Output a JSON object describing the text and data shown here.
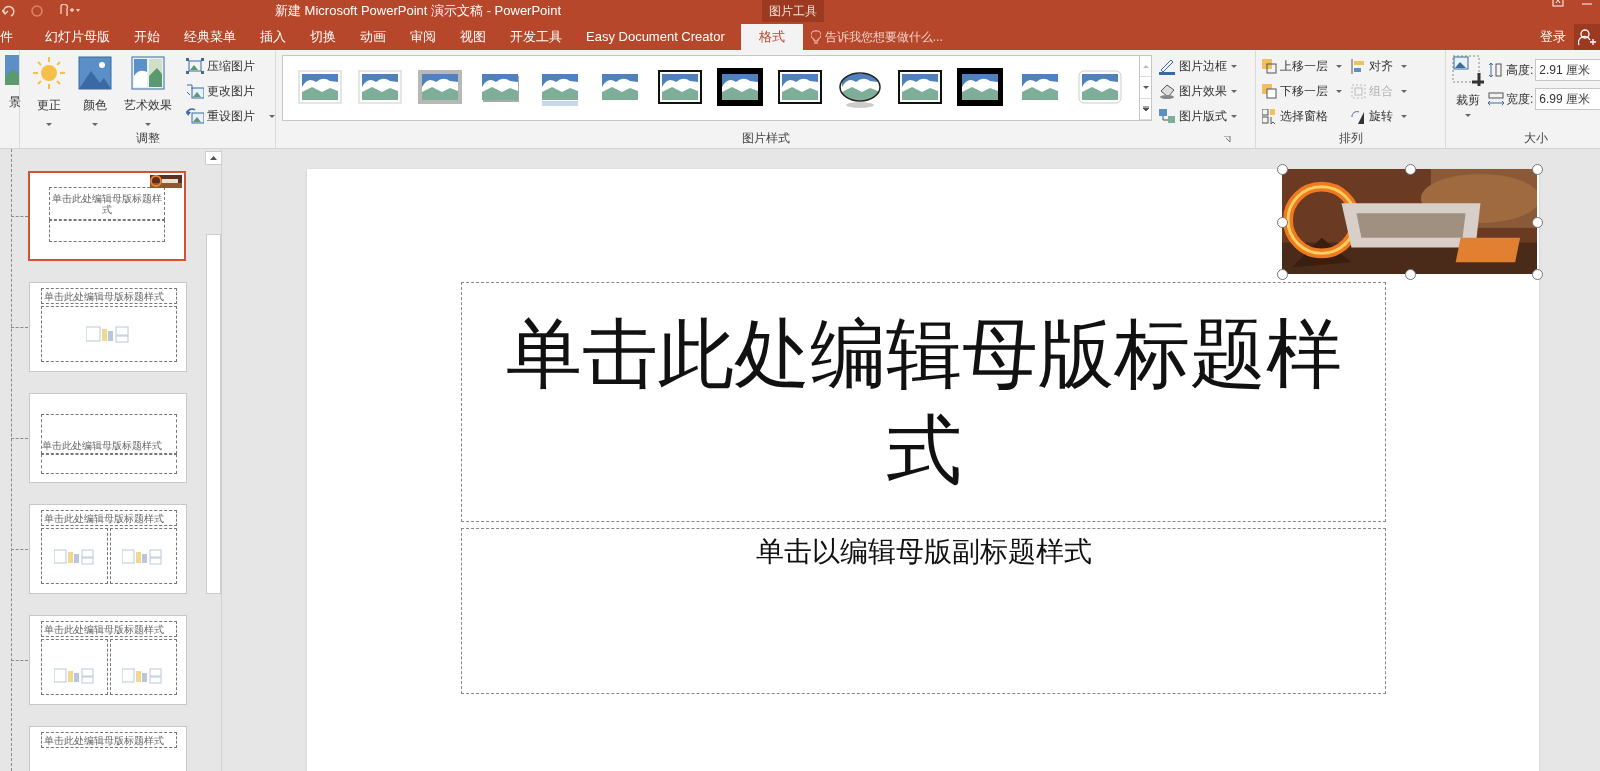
{
  "title_bar": {
    "title": "新建 Microsoft PowerPoint 演示文稿 - PowerPoint",
    "context_label": "图片工具"
  },
  "tabs": [
    {
      "label": "件",
      "selected": false
    },
    {
      "label": "幻灯片母版",
      "selected": false
    },
    {
      "label": "开始",
      "selected": false
    },
    {
      "label": "经典菜单",
      "selected": false
    },
    {
      "label": "插入",
      "selected": false
    },
    {
      "label": "切换",
      "selected": false
    },
    {
      "label": "动画",
      "selected": false
    },
    {
      "label": "审阅",
      "selected": false
    },
    {
      "label": "视图",
      "selected": false
    },
    {
      "label": "开发工具",
      "selected": false
    },
    {
      "label": "Easy Document Creator",
      "selected": false
    },
    {
      "label": "格式",
      "selected": true
    }
  ],
  "tell_me": {
    "placeholder": "告诉我您想要做什么..."
  },
  "account": {
    "sign_in": "登录"
  },
  "ribbon": {
    "background_group": {
      "label": "景"
    },
    "adjust": {
      "title": "调整",
      "large": [
        {
          "kind": "sun",
          "label": "更正"
        },
        {
          "kind": "color",
          "label": "颜色"
        },
        {
          "kind": "art",
          "label": "艺术效果"
        }
      ],
      "small": [
        {
          "kind": "compress",
          "label": "压缩图片"
        },
        {
          "kind": "change",
          "label": "更改图片"
        },
        {
          "kind": "reset",
          "label": "重设图片"
        }
      ]
    },
    "styles": {
      "title": "图片样式",
      "gallery": [
        {
          "kind": "plain"
        },
        {
          "kind": "thin"
        },
        {
          "kind": "gray"
        },
        {
          "kind": "shadow"
        },
        {
          "kind": "reflect"
        },
        {
          "kind": "soft"
        },
        {
          "kind": "black"
        },
        {
          "kind": "heavy"
        },
        {
          "kind": "black"
        },
        {
          "kind": "oval"
        },
        {
          "kind": "black"
        },
        {
          "kind": "heavy"
        },
        {
          "kind": "soft"
        },
        {
          "kind": "rounded"
        }
      ],
      "options": [
        {
          "kind": "border",
          "label": "图片边框"
        },
        {
          "kind": "effects",
          "label": "图片效果"
        },
        {
          "kind": "layout",
          "label": "图片版式"
        }
      ]
    },
    "arrange": {
      "title": "排列",
      "items": [
        {
          "kind": "forward",
          "label": "上移一层",
          "disabled": false
        },
        {
          "kind": "align",
          "label": "对齐",
          "disabled": false
        },
        {
          "kind": "backward",
          "label": "下移一层",
          "disabled": false
        },
        {
          "kind": "group",
          "label": "组合",
          "disabled": true
        },
        {
          "kind": "pane",
          "label": "选择窗格",
          "disabled": false
        },
        {
          "kind": "rotate",
          "label": "旋转",
          "disabled": false
        }
      ]
    },
    "size": {
      "title": "大小",
      "crop": "裁剪",
      "height": {
        "label": "高度:",
        "value": "2.91 厘米"
      },
      "width": {
        "label": "宽度:",
        "value": "6.99 厘米"
      }
    }
  },
  "thumbnails": [
    {
      "kind": "title",
      "title": "单击此处编辑母版标题样式",
      "selected": true,
      "has_picture": true
    },
    {
      "kind": "content",
      "title": "单击此处编辑母版标题样式",
      "selected": false,
      "has_picture": false
    },
    {
      "kind": "section",
      "title": "单击此处编辑母版标题样式",
      "selected": false,
      "has_picture": false
    },
    {
      "kind": "two",
      "title": "单击此处编辑母版标题样式",
      "selected": false,
      "has_picture": false
    },
    {
      "kind": "comparison",
      "title": "单击此处编辑母版标题样式",
      "selected": false,
      "has_picture": false
    },
    {
      "kind": "title_only",
      "title": "单击此处编辑母版标题样式",
      "selected": false,
      "has_picture": false
    }
  ],
  "slide": {
    "title": "单击此处编辑母版标题样式",
    "subtitle": "单击以编辑母版副标题样式",
    "picture": {
      "selected": true
    }
  }
}
